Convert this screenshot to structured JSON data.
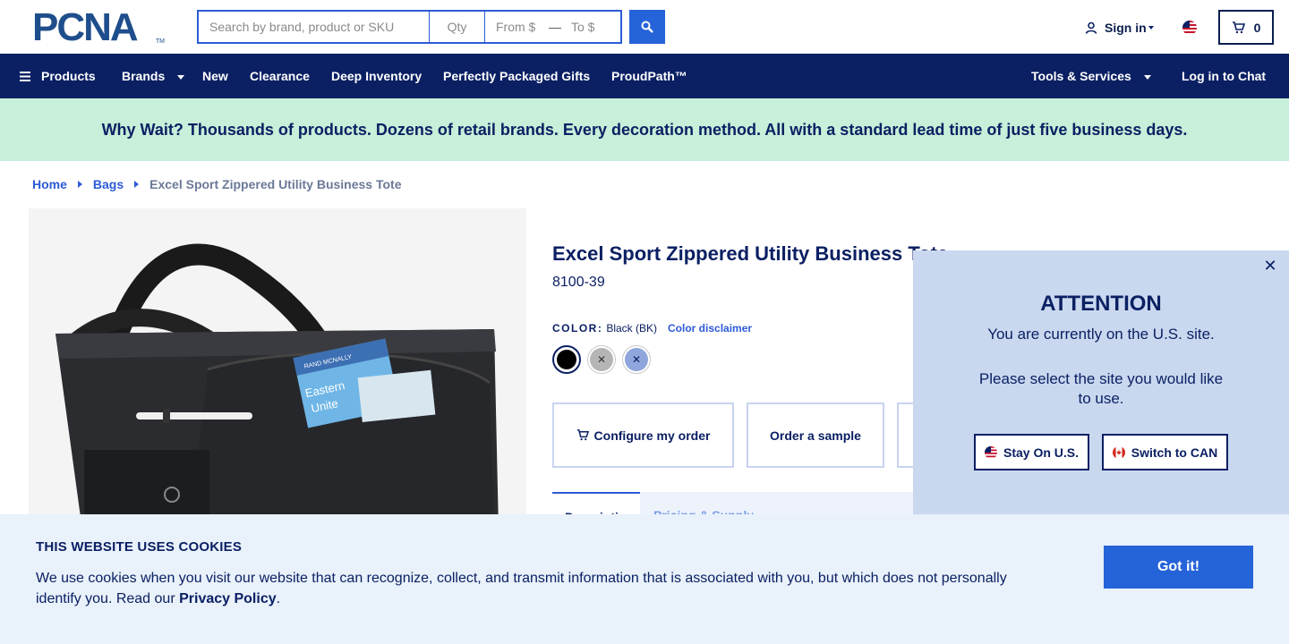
{
  "header": {
    "logo_text": "PCNA",
    "logo_tm": "TM",
    "search_placeholder": "Search by brand, product or SKU",
    "qty_placeholder": "Qty",
    "from_placeholder": "From $",
    "range_dash": "—",
    "to_placeholder": "To $",
    "sign_in_label": "Sign in",
    "cart_count": "0"
  },
  "nav": {
    "products": "Products",
    "brands": "Brands",
    "new": "New",
    "clearance": "Clearance",
    "deep_inventory": "Deep Inventory",
    "gifts": "Perfectly Packaged Gifts",
    "proudpath": "ProudPath™",
    "tools": "Tools & Services",
    "chat": "Log in to Chat"
  },
  "promo": {
    "text": "Why Wait? Thousands of products. Dozens of retail brands. Every decoration method. All with a standard lead time of just five business days."
  },
  "breadcrumb": {
    "home": "Home",
    "bags": "Bags",
    "current": "Excel Sport Zippered Utility Business Tote"
  },
  "product": {
    "title": "Excel Sport Zippered Utility Business Tote",
    "sku": "8100-39",
    "color_label": "COLOR:",
    "color_value": "Black (BK)",
    "color_disclaimer": "Color disclaimer",
    "swatch_x": "✕",
    "configure_label": "Configure my order",
    "sample_label": "Order a sample",
    "tab_description": "Description",
    "tab_pricing": "Pricing & Supply",
    "image_insert_text_1": "RAND MCNALLY",
    "image_insert_text_2": "Eastern",
    "image_insert_text_3": "Unite"
  },
  "modal": {
    "close": "✕",
    "title": "ATTENTION",
    "line1": "You are currently on the U.S. site.",
    "line2": "Please select the site you would like to use.",
    "stay_label": "Stay On U.S.",
    "switch_label": "Switch to CAN"
  },
  "cookies": {
    "title": "THIS WEBSITE USES COOKIES",
    "text_before": "We use cookies when you visit our website that can recognize, collect, and transmit information that is associated with you, but which does not personally identify you. Read our ",
    "privacy_link": "Privacy Policy",
    "text_after": ".",
    "button": "Got it!"
  },
  "colors": {
    "navy": "#0b2063",
    "accent_blue": "#2563d9",
    "promo_bg": "#c7efd9",
    "modal_bg": "#c9d8ef",
    "cookie_bg": "#e9f1fa"
  },
  "icons": {
    "search": "search-icon",
    "user": "user-icon",
    "flag": "us-flag-icon",
    "cart": "cart-icon",
    "menu": "hamburger-icon",
    "close": "close-icon"
  }
}
